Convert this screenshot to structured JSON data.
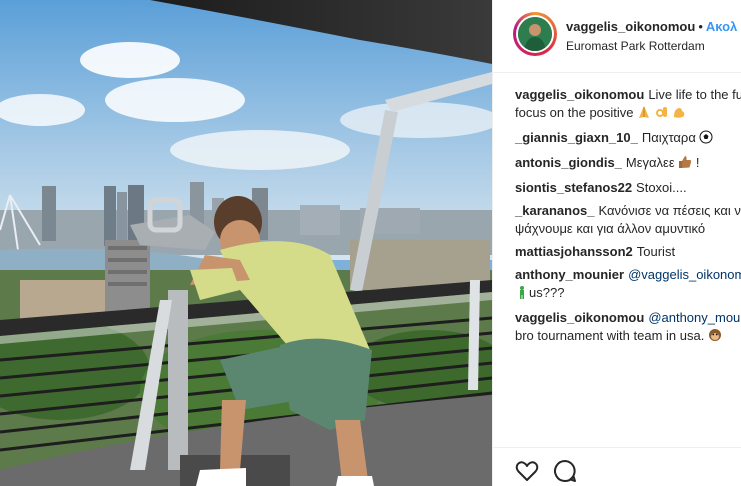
{
  "post": {
    "username": "vaggelis_oikonomou",
    "separator": "•",
    "follow_label": "Ακολ",
    "location": "Euromast Park Rotterdam"
  },
  "comments": [
    {
      "user": "vaggelis_oikonomou",
      "lines": [
        "Live life to the fu",
        "focus on the positive"
      ],
      "emoji": [
        "folded-hands",
        "ok-hand",
        "flexed-biceps"
      ]
    },
    {
      "user": "_giannis_giaxn_10_",
      "lines": [
        "Παιχταρα"
      ],
      "emoji": [
        "soccer-ball"
      ]
    },
    {
      "user": "antonis_giondis_",
      "lines": [
        "Μεγαλεε"
      ],
      "emoji": [
        "thumbs-up",
        "!"
      ]
    },
    {
      "user": "siontis_stefanos22",
      "lines": [
        "Stoxoi...."
      ]
    },
    {
      "user": "_karananos_",
      "lines": [
        "Κανόνισε να πέσεις και ν",
        "ψάχνουμε και για άλλον αμυντικό"
      ]
    },
    {
      "user": "mattiasjohansson2",
      "lines": [
        "Tourist"
      ]
    },
    {
      "user": "anthony_mounier",
      "mention": "@vaggelis_oikonomo",
      "lines": [
        "us???"
      ],
      "emoji": [
        "person-standing"
      ]
    },
    {
      "user": "vaggelis_oikonomou",
      "mention": "@anthony_mounier",
      "lines": [
        "bro tournament with team in usa."
      ],
      "emoji": [
        "monkey-face"
      ]
    }
  ],
  "actions": {
    "like_icon": "heart-icon",
    "comment_icon": "comment-bubble-icon"
  },
  "colors": {
    "follow": "#3897f0",
    "text": "#262626",
    "mention": "#003569",
    "border": "#efefef"
  }
}
